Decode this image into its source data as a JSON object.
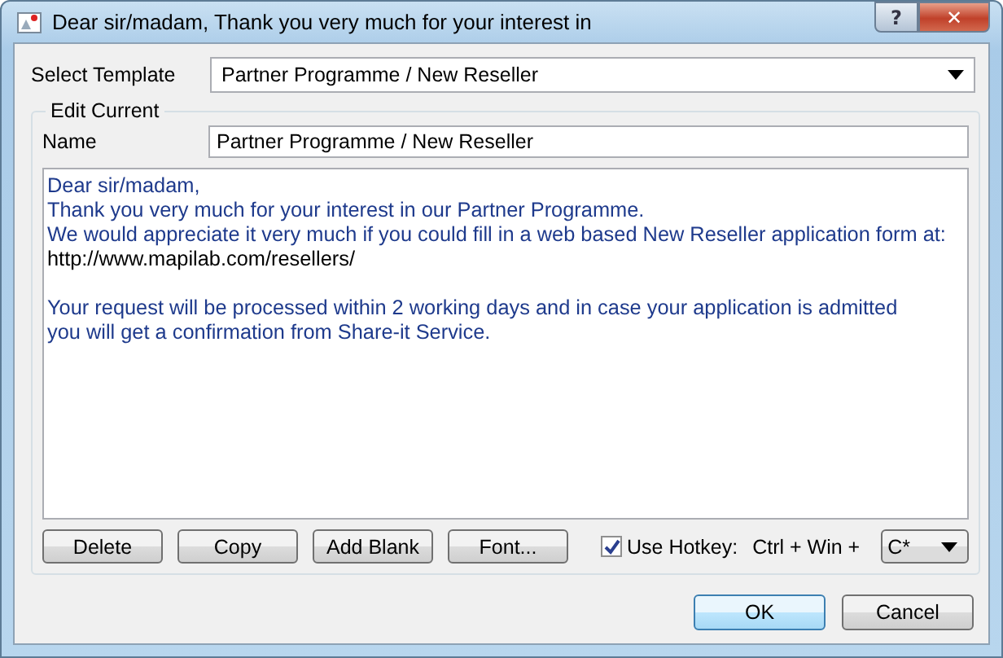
{
  "window": {
    "title": "Dear sir/madam, Thank you very much for your interest in",
    "help": "?",
    "close": "✕"
  },
  "template": {
    "label": "Select Template",
    "value": "Partner Programme / New Reseller"
  },
  "edit_group": {
    "title": "Edit Current",
    "name_label": "Name",
    "name_value": "Partner Programme / New Reseller",
    "paragraphs": [
      [
        {
          "kind": "text",
          "text": "Dear sir/madam,"
        },
        {
          "kind": "text",
          "text": "Thank you very much for your interest in our Partner Programme."
        },
        {
          "kind": "text",
          "text": "We would appreciate it very much if you could fill in a web based New Reseller application form at:"
        },
        {
          "kind": "url",
          "text": "http://www.mapilab.com/resellers/"
        }
      ],
      [
        {
          "kind": "text",
          "text": "Your request will be processed within 2 working days and in case your application is admitted"
        },
        {
          "kind": "text",
          "text": "you will get a confirmation from Share-it Service."
        }
      ]
    ],
    "buttons": [
      "Delete",
      "Copy",
      "Add Blank",
      "Font..."
    ],
    "hotkey": {
      "label": "Use Hotkey:",
      "checked": true,
      "prefix": "Ctrl + Win +",
      "key": "C*"
    }
  },
  "buttons": [
    {
      "label": "OK",
      "default": true
    },
    {
      "label": "Cancel",
      "default": false
    }
  ]
}
